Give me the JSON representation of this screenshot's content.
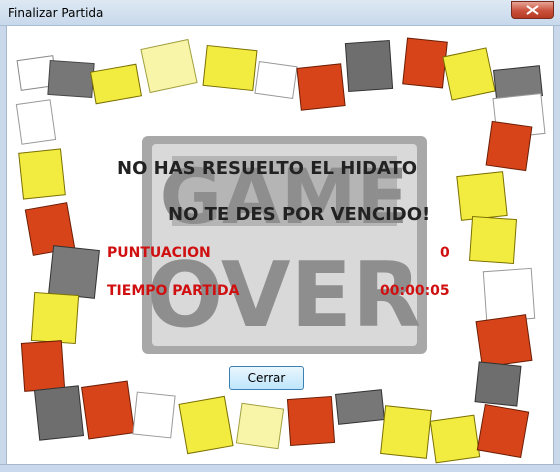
{
  "window": {
    "title": "Finalizar Partida"
  },
  "background": {
    "logo_text_top": "GAME",
    "logo_text_bottom": "OVER"
  },
  "messages": {
    "line1": "NO HAS RESUELTO EL HIDATO",
    "line2": "NO TE DES POR VENCIDO!"
  },
  "stats": {
    "score_label": "PUNTUACION",
    "score_value": "0",
    "time_label": "TIEMPO PARTIDA",
    "time_value": "00:00:05"
  },
  "buttons": {
    "close_label": "Cerrar"
  },
  "colors": {
    "yellow": "#f7f23a",
    "orange": "#d8441a",
    "gray": "#6b6b6b",
    "accent_red": "#d01010"
  }
}
